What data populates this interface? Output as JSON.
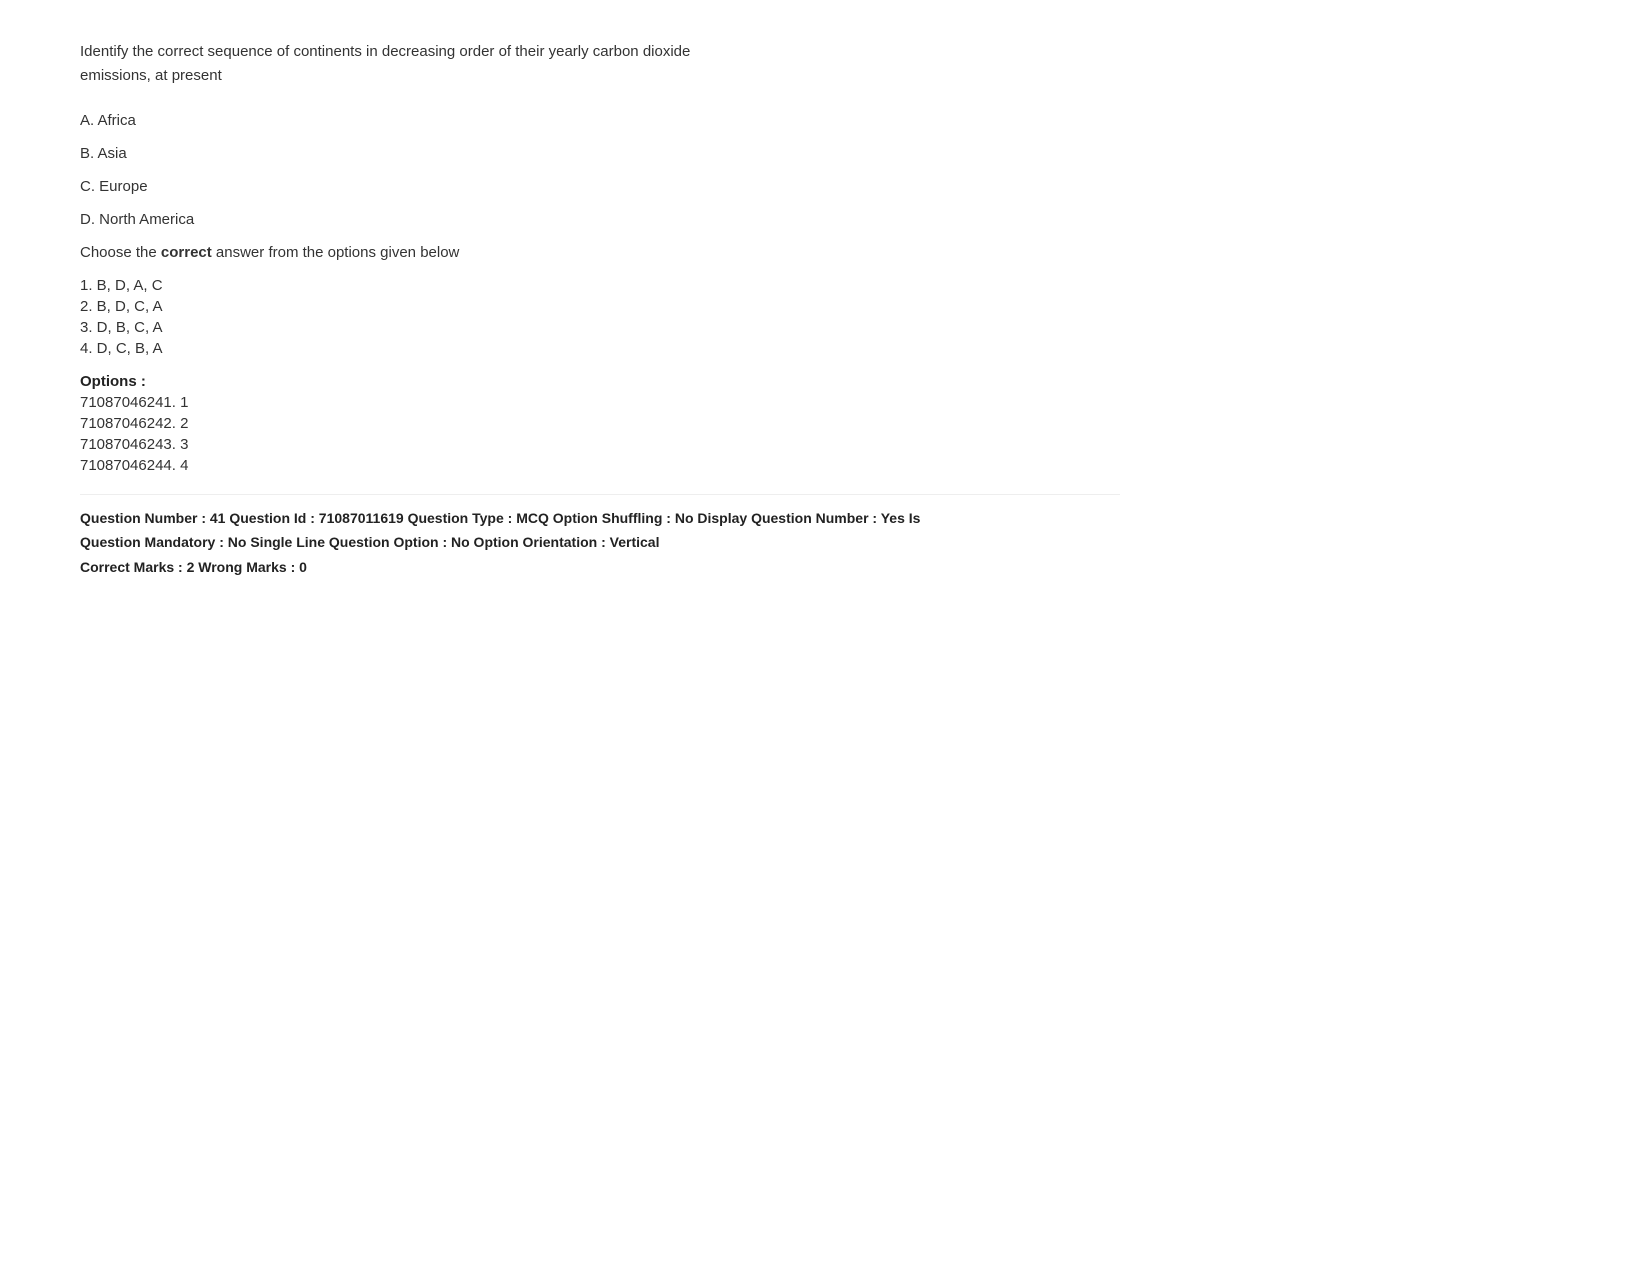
{
  "question": {
    "text_line1": "Identify the correct sequence of continents in decreasing order of their yearly carbon dioxide",
    "text_line2": "emissions, at present",
    "options": [
      {
        "label": "A. Africa"
      },
      {
        "label": "B. Asia"
      },
      {
        "label": "C. Europe"
      },
      {
        "label": "D. North America"
      }
    ],
    "instruction_prefix": "Choose the ",
    "instruction_bold": "correct",
    "instruction_suffix": " answer from the options given below",
    "answer_options": [
      {
        "label": "1. B, D, A, C"
      },
      {
        "label": "2. B, D, C, A"
      },
      {
        "label": "3. D, B, C, A"
      },
      {
        "label": "4. D, C, B, A"
      }
    ],
    "options_section_label": "Options :",
    "option_ids": [
      {
        "label": "71087046241. 1"
      },
      {
        "label": "71087046242. 2"
      },
      {
        "label": "71087046243. 3"
      },
      {
        "label": "71087046244. 4"
      }
    ],
    "metadata_line1": "Question Number : 41 Question Id : 71087011619 Question Type : MCQ Option Shuffling : No Display Question Number : Yes Is",
    "metadata_line2": "Question Mandatory : No Single Line Question Option : No Option Orientation : Vertical",
    "marks_line": "Correct Marks : 2 Wrong Marks : 0"
  }
}
